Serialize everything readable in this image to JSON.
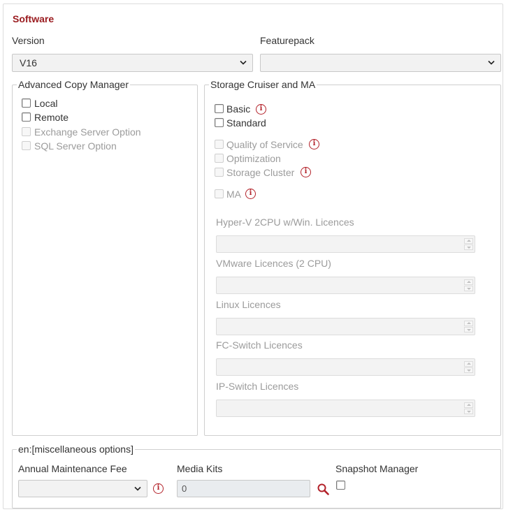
{
  "section_title": "Software",
  "version": {
    "label": "Version",
    "value": "V16"
  },
  "featurepack": {
    "label": "Featurepack",
    "value": ""
  },
  "acm": {
    "legend": "Advanced Copy Manager",
    "options": [
      {
        "label": "Local",
        "enabled": true
      },
      {
        "label": "Remote",
        "enabled": true
      },
      {
        "label": "Exchange Server Option",
        "enabled": false
      },
      {
        "label": "SQL Server Option",
        "enabled": false
      }
    ]
  },
  "scma": {
    "legend": "Storage Cruiser and MA",
    "basic": "Basic",
    "standard": "Standard",
    "qos": "Quality of Service",
    "optimization": "Optimization",
    "cluster": "Storage Cluster",
    "ma": "MA",
    "licences": [
      {
        "label": "Hyper-V 2CPU w/Win. Licences"
      },
      {
        "label": "VMware Licences (2 CPU)"
      },
      {
        "label": "Linux Licences"
      },
      {
        "label": "FC-Switch Licences"
      },
      {
        "label": "IP-Switch Licences"
      }
    ]
  },
  "misc": {
    "legend": "en:[miscellaneous options]",
    "annual_fee": {
      "label": "Annual Maintenance Fee",
      "value": ""
    },
    "media_kits": {
      "label": "Media Kits",
      "value": "0"
    },
    "snapshot": {
      "label": "Snapshot Manager"
    }
  },
  "colors": {
    "accent": "#9a1b1f",
    "info": "#b3222a"
  }
}
